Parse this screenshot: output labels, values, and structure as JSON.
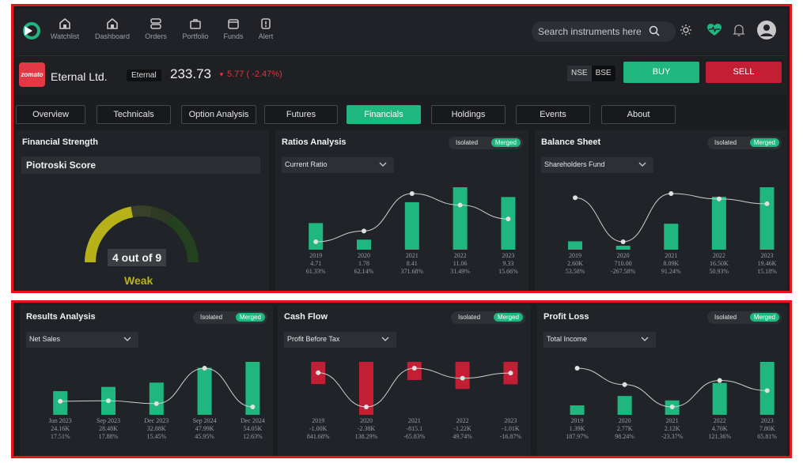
{
  "nav": {
    "items": [
      {
        "label": "Watchlist",
        "icon": "watchlist-icon"
      },
      {
        "label": "Dashboard",
        "icon": "dashboard-icon"
      },
      {
        "label": "Orders",
        "icon": "orders-icon"
      },
      {
        "label": "Portfolio",
        "icon": "portfolio-icon"
      },
      {
        "label": "Funds",
        "icon": "funds-icon"
      },
      {
        "label": "Alert",
        "icon": "alert-icon"
      }
    ],
    "search_placeholder": "Search instruments here"
  },
  "stock": {
    "logo_text": "zomato",
    "name": "Eternal Ltd.",
    "ticker": "Eternal",
    "price": "233.73",
    "change": "5.77 ( -2.47%)",
    "exchange": [
      "NSE",
      "BSE"
    ],
    "buy_label": "BUY",
    "sell_label": "SELL"
  },
  "tabs": [
    "Overview",
    "Technicals",
    "Option Analysis",
    "Futures",
    "Financials",
    "Holdings",
    "Events",
    "About"
  ],
  "toggle": {
    "isolated": "Isolated",
    "merged": "Merged"
  },
  "colors": {
    "green": "#20b67f",
    "red": "#c21f35",
    "accent": "#20b67f",
    "gauge": "#b7b21a"
  },
  "financial_strength": {
    "title": "Financial Strength",
    "subtitle": "Piotroski Score",
    "score_text": "4 out of 9",
    "rating": "Weak",
    "score": 4,
    "max": 9
  },
  "panels": [
    {
      "id": "ratios",
      "title": "Ratios Analysis",
      "dropdown": "Current Ratio",
      "chart_data": {
        "type": "bar",
        "categories": [
          "2019",
          "2020",
          "2021",
          "2022",
          "2023"
        ],
        "values": [
          4.71,
          1.78,
          8.41,
          11.06,
          9.33
        ],
        "labels": [
          "4.71",
          "1.78",
          "8.41",
          "11.06",
          "9.33"
        ],
        "pct": [
          "61.33%",
          "62.14%",
          "371.68%",
          "31.49%",
          "15.66%"
        ],
        "line": [
          7.8,
          11.2,
          23.0,
          19.4,
          15.0
        ]
      }
    },
    {
      "id": "balance",
      "title": "Balance Sheet",
      "dropdown": "Shareholders Fund",
      "chart_data": {
        "type": "bar",
        "categories": [
          "2019",
          "2020",
          "2021",
          "2022",
          "2023"
        ],
        "values": [
          2.6,
          0.71,
          8.09,
          16.5,
          19.46
        ],
        "labels": [
          "2.60K",
          "710.00",
          "8.09K",
          "16.50K",
          "19.46K"
        ],
        "pct": [
          "53.58%",
          "-267.58%",
          "91.24%",
          "50.93%",
          "15.18%"
        ],
        "line": [
          60,
          -268,
          91,
          51,
          15
        ]
      }
    },
    {
      "id": "results",
      "title": "Results Analysis",
      "dropdown": "Net Sales",
      "chart_data": {
        "type": "bar",
        "categories": [
          "Jun 2023",
          "Sep 2023",
          "Dec 2023",
          "Sep 2024",
          "Dec 2024"
        ],
        "values": [
          24.16,
          28.48,
          32.88,
          47.99,
          54.05
        ],
        "labels": [
          "24.16K",
          "28.48K",
          "32.88K",
          "47.99K",
          "54.05K"
        ],
        "pct": [
          "17.51%",
          "17.88%",
          "15.45%",
          "45.95%",
          "12.63%"
        ],
        "line": [
          17.51,
          17.88,
          15.45,
          45.95,
          12.63
        ]
      }
    },
    {
      "id": "cashflow",
      "title": "Cash Flow",
      "dropdown": "Profit Before Tax",
      "chart_data": {
        "type": "bar",
        "categories": [
          "2019",
          "2020",
          "2021",
          "2022",
          "2023"
        ],
        "values": [
          -1.0,
          -2.38,
          -0.8151,
          -1.22,
          -1.01
        ],
        "labels": [
          "-1.00K",
          "-2.38K",
          "-815.1",
          "-1.22K",
          "-1.01K"
        ],
        "pct": [
          "841.68%",
          "138.29%",
          "-65.83%",
          "49.74%",
          "-16.87%"
        ],
        "line": [
          -1.0,
          -2.38,
          -0.8151,
          -1.22,
          -1.01
        ]
      }
    },
    {
      "id": "profitloss",
      "title": "Profit Loss",
      "dropdown": "Total Income",
      "chart_data": {
        "type": "bar",
        "categories": [
          "2019",
          "2020",
          "2021",
          "2022",
          "2023"
        ],
        "values": [
          1.39,
          2.77,
          2.12,
          4.7,
          7.8
        ],
        "labels": [
          "1.39K",
          "2.77K",
          "2.12K",
          "4.70K",
          "7.80K"
        ],
        "pct": [
          "187.97%",
          "98.24%",
          "-23.37%",
          "121.36%",
          "65.81%"
        ],
        "line": [
          187.97,
          98.24,
          -23.37,
          121.36,
          65.81
        ]
      }
    }
  ]
}
